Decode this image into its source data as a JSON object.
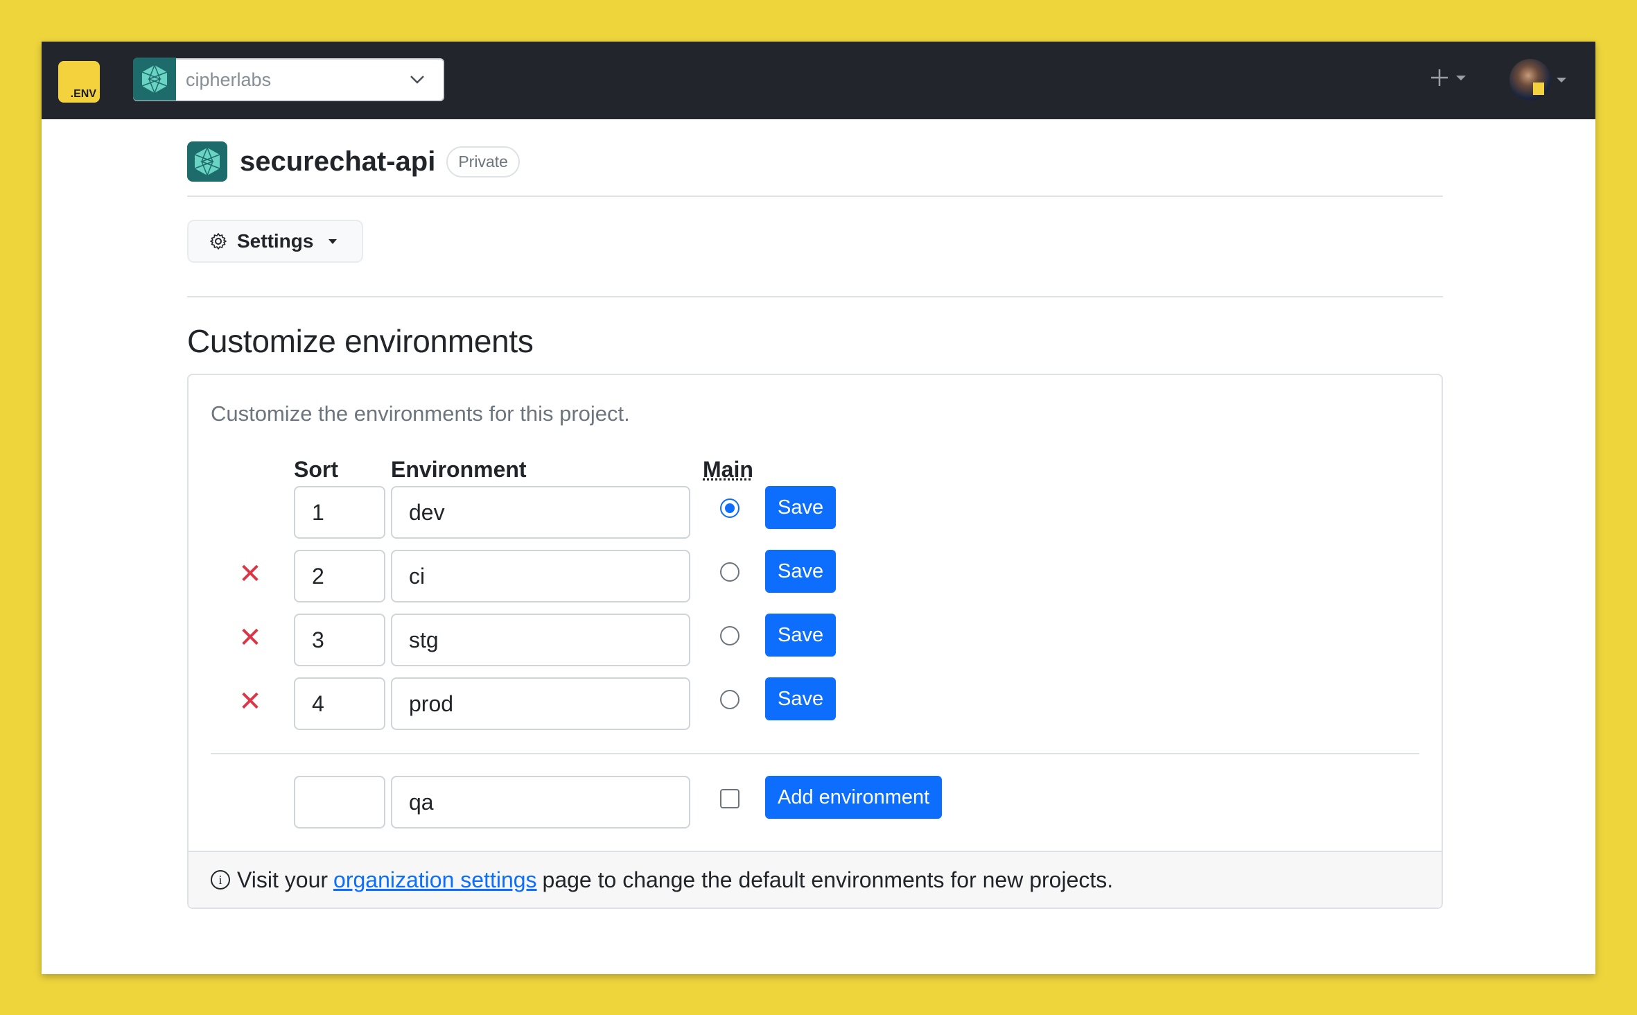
{
  "navbar": {
    "logo_text": ".ENV",
    "org_selected": "cipherlabs"
  },
  "project": {
    "name": "securechat-api",
    "visibility": "Private"
  },
  "settings_menu": {
    "label": "Settings"
  },
  "section": {
    "title": "Customize environments",
    "description": "Customize the environments for this project."
  },
  "table": {
    "headers": {
      "sort": "Sort",
      "environment": "Environment",
      "main": "Main"
    },
    "rows": [
      {
        "sort": "1",
        "environment": "dev",
        "main": true,
        "deletable": false,
        "action": "Save"
      },
      {
        "sort": "2",
        "environment": "ci",
        "main": false,
        "deletable": true,
        "action": "Save"
      },
      {
        "sort": "3",
        "environment": "stg",
        "main": false,
        "deletable": true,
        "action": "Save"
      },
      {
        "sort": "4",
        "environment": "prod",
        "main": false,
        "deletable": true,
        "action": "Save"
      }
    ],
    "new_row": {
      "sort": "",
      "environment": "qa",
      "main": false,
      "action": "Add environment"
    }
  },
  "footer": {
    "prefix": "Visit your",
    "link": "organization settings",
    "suffix": "page to change the default environments for new projects."
  },
  "colors": {
    "primary": "#0d6efd",
    "danger": "#dc3545",
    "navbar": "#22262c",
    "brand_yellow": "#f4d23d",
    "project_teal": "#1e6b6b"
  },
  "icons": {
    "logo": "dotenv-logo-icon",
    "org": "hexagon-logo-icon",
    "dropdown": "chevron-down-icon",
    "add": "plus-icon",
    "settings": "gear-icon",
    "delete": "close-icon",
    "info": "info-icon"
  }
}
